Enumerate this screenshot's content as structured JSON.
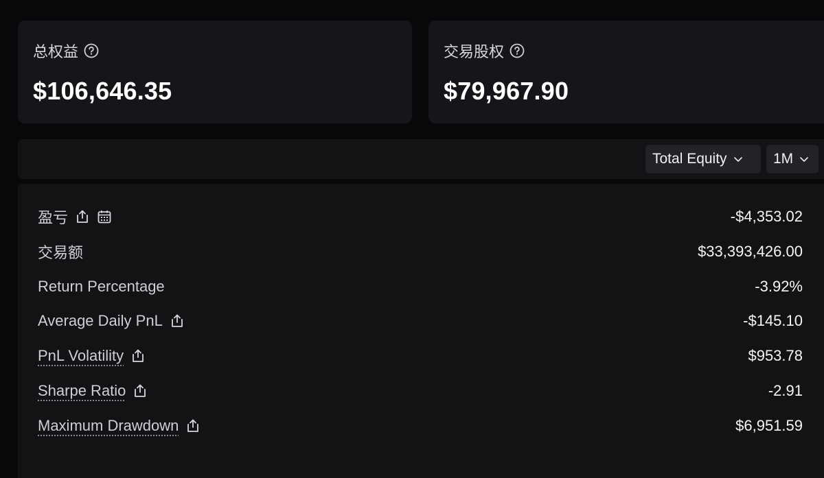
{
  "cards": {
    "total_equity": {
      "label": "总权益",
      "value": "$106,646.35"
    },
    "trading_equity": {
      "label": "交易股权",
      "value": "$79,967.90"
    }
  },
  "toolbar": {
    "metric_select": "Total Equity",
    "range_select": "1M"
  },
  "stats": [
    {
      "label": "盈亏",
      "value": "-$4,353.02"
    },
    {
      "label": "交易额",
      "value": "$33,393,426.00"
    },
    {
      "label": "Return Percentage",
      "value": "-3.92%"
    },
    {
      "label": "Average Daily PnL",
      "value": "-$145.10"
    },
    {
      "label": "PnL Volatility",
      "value": "$953.78"
    },
    {
      "label": "Sharpe Ratio",
      "value": "-2.91"
    },
    {
      "label": "Maximum Drawdown",
      "value": "$6,951.59"
    }
  ],
  "icons": {
    "help": "help-circle-icon",
    "share": "share-icon",
    "calendar": "calendar-icon",
    "chevron": "chevron-down-icon"
  },
  "colors": {
    "background": "#08080a",
    "card": "#16161a",
    "panel": "#131316",
    "dropdown": "#222228",
    "text_primary": "#ffffff",
    "text_secondary": "#cfcfd4"
  }
}
